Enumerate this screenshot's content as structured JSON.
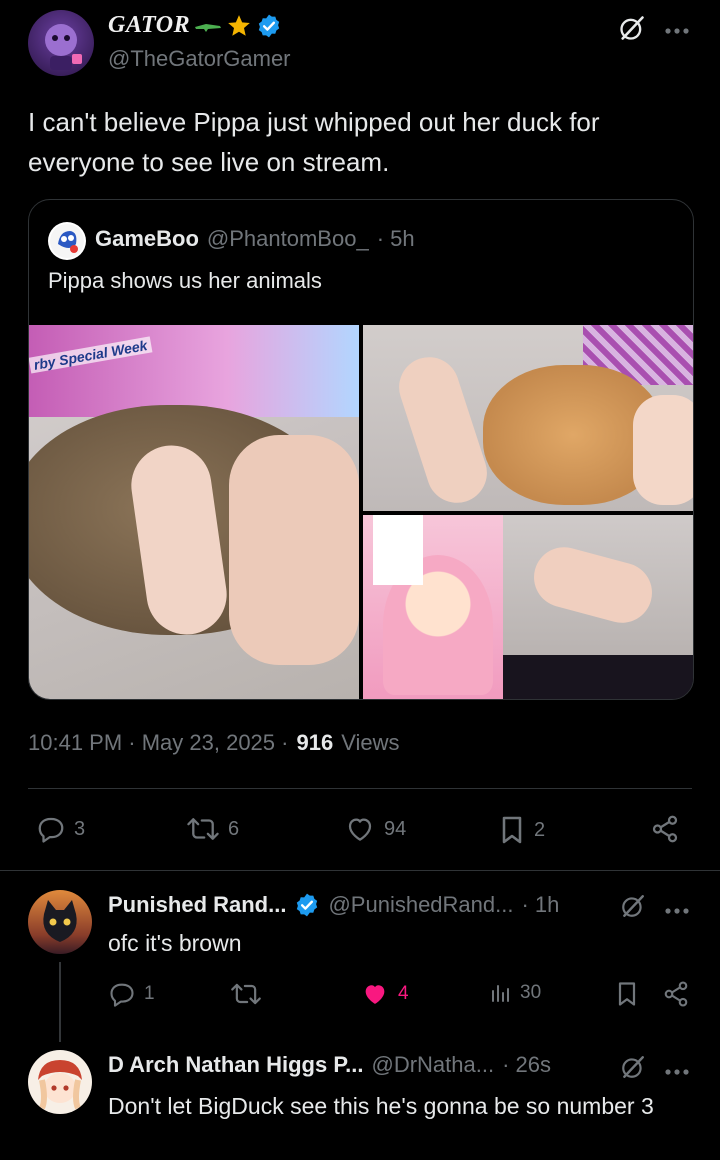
{
  "main_tweet": {
    "display_name": "GATOR",
    "handle": "@TheGatorGamer",
    "text": "I can't believe Pippa just whipped out her duck for everyone to see live on stream.",
    "timestamp": "10:41 PM · May 23, 2025 ·",
    "views_count": "916",
    "views_label": "Views",
    "actions": {
      "replies": "3",
      "retweets": "6",
      "likes": "94",
      "bookmarks": "2"
    }
  },
  "quote": {
    "display_name": "GameBoo",
    "handle": "@PhantomBoo_",
    "age": "· 5h",
    "text": "Pippa shows us her animals",
    "image1_text": "rby Special Week"
  },
  "reply1": {
    "display_name": "Punished Rand...",
    "handle": "@PunishedRand...",
    "age": "· 1h",
    "text": "ofc it's brown",
    "actions": {
      "replies": "1",
      "likes": "4",
      "views": "30"
    }
  },
  "reply2": {
    "display_name": "D Arch Nathan Higgs P...",
    "handle": "@DrNatha...",
    "age": "· 26s",
    "text": "Don't let BigDuck see this he's gonna be so number 3"
  },
  "colors": {
    "accent_blue": "#1d9bf0",
    "like_pink": "#f91880",
    "muted": "#71767b",
    "border": "#2f3336",
    "star": "#f4b400",
    "gator": "#4caf50"
  }
}
